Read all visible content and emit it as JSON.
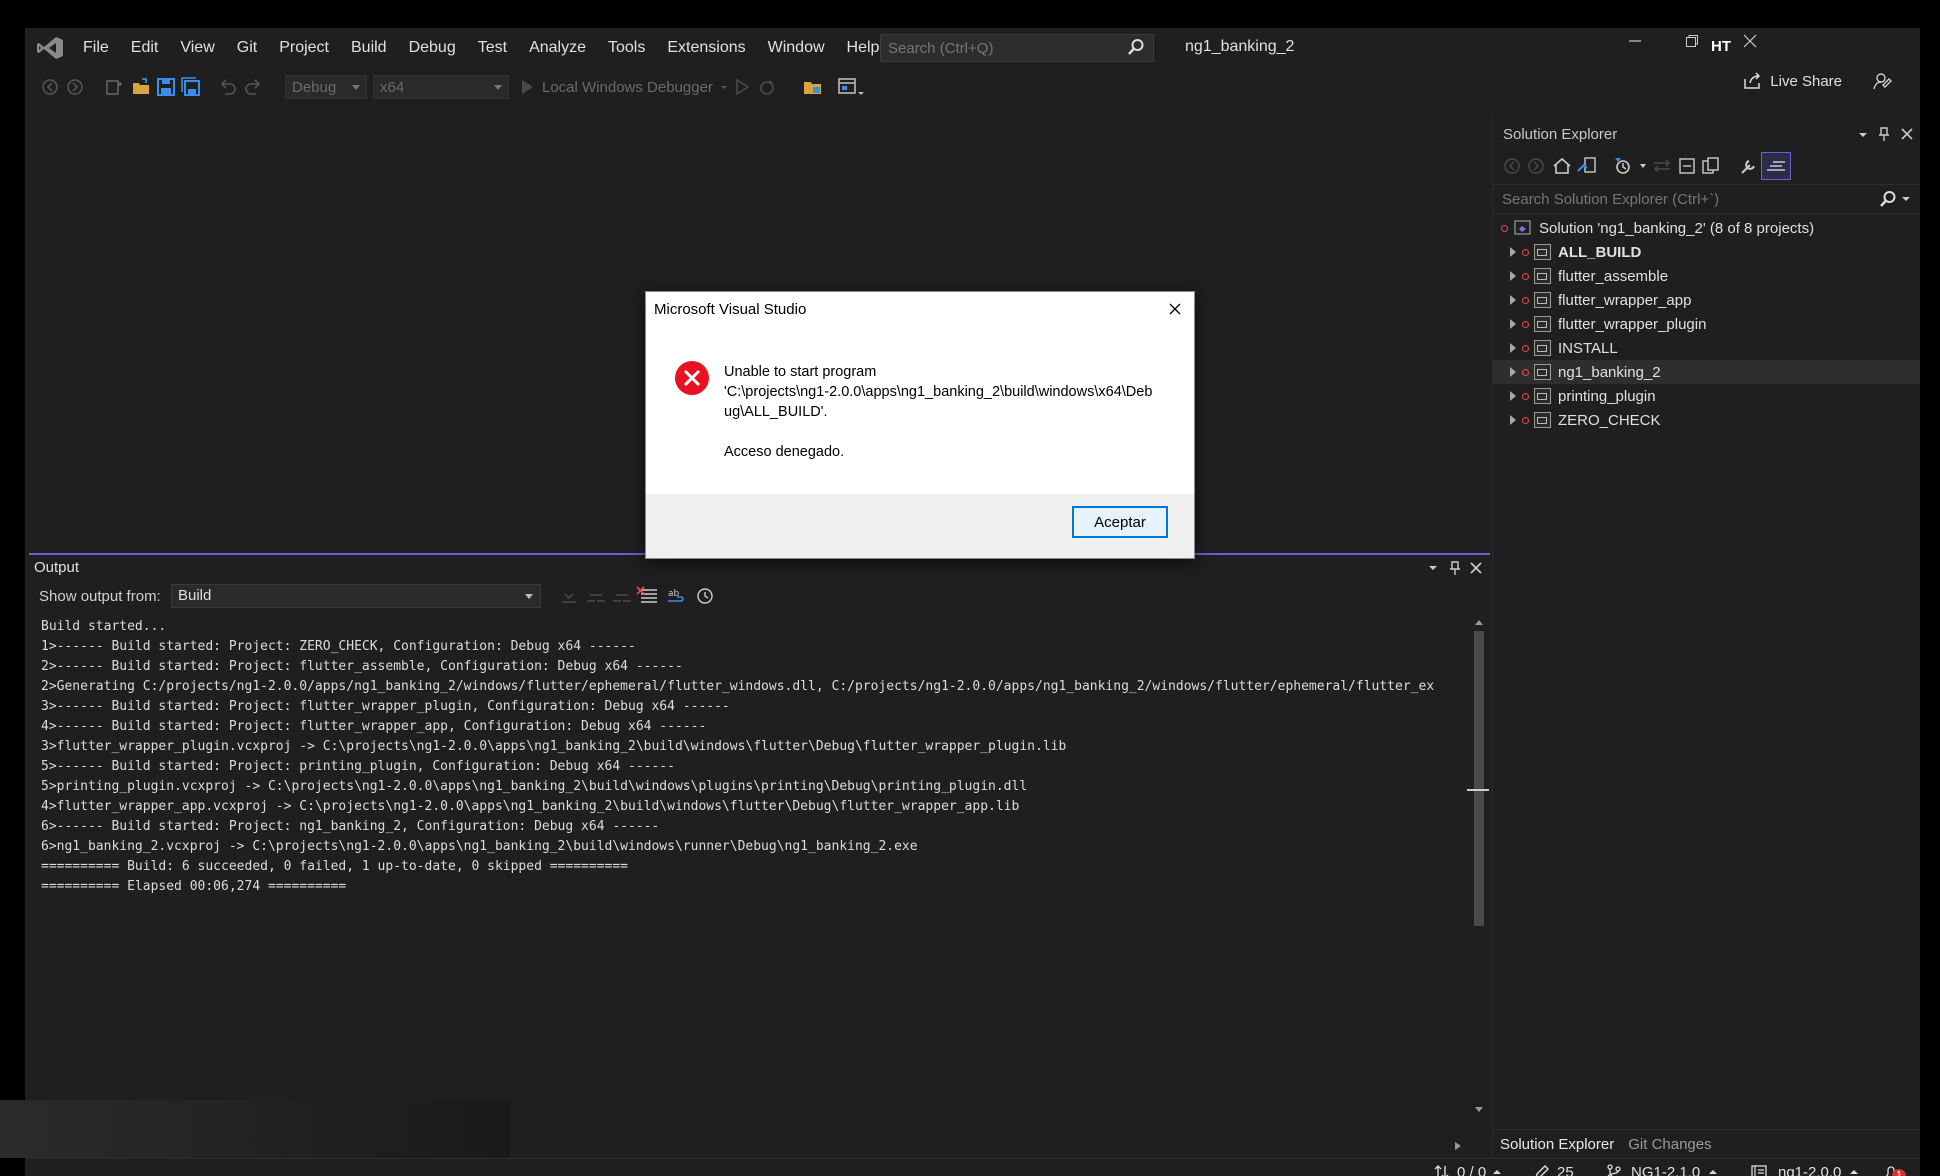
{
  "menu": {
    "items": [
      "File",
      "Edit",
      "View",
      "Git",
      "Project",
      "Build",
      "Debug",
      "Test",
      "Analyze",
      "Tools",
      "Extensions",
      "Window",
      "Help"
    ],
    "search_placeholder": "Search (Ctrl+Q)",
    "project_title": "ng1_banking_2",
    "user_initials": "HT"
  },
  "toolbar": {
    "config": "Debug",
    "platform": "x64",
    "debugger": "Local Windows Debugger",
    "live_share": "Live Share"
  },
  "solution_explorer": {
    "title": "Solution Explorer",
    "search_placeholder": "Search Solution Explorer (Ctrl+`)",
    "solution_label": "Solution 'ng1_banking_2' (8 of 8 projects)",
    "projects": [
      {
        "name": "ALL_BUILD",
        "bold": true,
        "selected": false
      },
      {
        "name": "flutter_assemble",
        "bold": false,
        "selected": false
      },
      {
        "name": "flutter_wrapper_app",
        "bold": false,
        "selected": false
      },
      {
        "name": "flutter_wrapper_plugin",
        "bold": false,
        "selected": false
      },
      {
        "name": "INSTALL",
        "bold": false,
        "selected": false
      },
      {
        "name": "ng1_banking_2",
        "bold": false,
        "selected": true
      },
      {
        "name": "printing_plugin",
        "bold": false,
        "selected": false
      },
      {
        "name": "ZERO_CHECK",
        "bold": false,
        "selected": false
      }
    ],
    "tabs": [
      "Solution Explorer",
      "Git Changes"
    ]
  },
  "output": {
    "title": "Output",
    "show_from_label": "Show output from:",
    "source": "Build",
    "lines": [
      "Build started...",
      "1>------ Build started: Project: ZERO_CHECK, Configuration: Debug x64 ------",
      "2>------ Build started: Project: flutter_assemble, Configuration: Debug x64 ------",
      "2>Generating C:/projects/ng1-2.0.0/apps/ng1_banking_2/windows/flutter/ephemeral/flutter_windows.dll, C:/projects/ng1-2.0.0/apps/ng1_banking_2/windows/flutter/ephemeral/flutter_ex",
      "3>------ Build started: Project: flutter_wrapper_plugin, Configuration: Debug x64 ------",
      "4>------ Build started: Project: flutter_wrapper_app, Configuration: Debug x64 ------",
      "3>flutter_wrapper_plugin.vcxproj -> C:\\projects\\ng1-2.0.0\\apps\\ng1_banking_2\\build\\windows\\flutter\\Debug\\flutter_wrapper_plugin.lib",
      "5>------ Build started: Project: printing_plugin, Configuration: Debug x64 ------",
      "5>printing_plugin.vcxproj -> C:\\projects\\ng1-2.0.0\\apps\\ng1_banking_2\\build\\windows\\plugins\\printing\\Debug\\printing_plugin.dll",
      "4>flutter_wrapper_app.vcxproj -> C:\\projects\\ng1-2.0.0\\apps\\ng1_banking_2\\build\\windows\\flutter\\Debug\\flutter_wrapper_app.lib",
      "6>------ Build started: Project: ng1_banking_2, Configuration: Debug x64 ------",
      "6>ng1_banking_2.vcxproj -> C:\\projects\\ng1-2.0.0\\apps\\ng1_banking_2\\build\\windows\\runner\\Debug\\ng1_banking_2.exe",
      "========== Build: 6 succeeded, 0 failed, 1 up-to-date, 0 skipped ==========",
      "========== Elapsed 00:06,274 =========="
    ]
  },
  "statusbar": {
    "changes": "0 / 0",
    "edits": "25",
    "branch": "NG1-2.1.0",
    "repo": "ng1-2.0.0",
    "notifications": "1"
  },
  "dialog": {
    "title": "Microsoft Visual Studio",
    "message_line1": "Unable to start program",
    "message_line2": "'C:\\projects\\ng1-2.0.0\\apps\\ng1_banking_2\\build\\windows\\x64\\Deb",
    "message_line3": "ug\\ALL_BUILD'.",
    "message_detail": "Acceso denegado.",
    "ok_label": "Aceptar"
  },
  "colors": {
    "accent": "#6e5fd3",
    "error": "#e81123",
    "dialog_button_border": "#0078d7"
  }
}
